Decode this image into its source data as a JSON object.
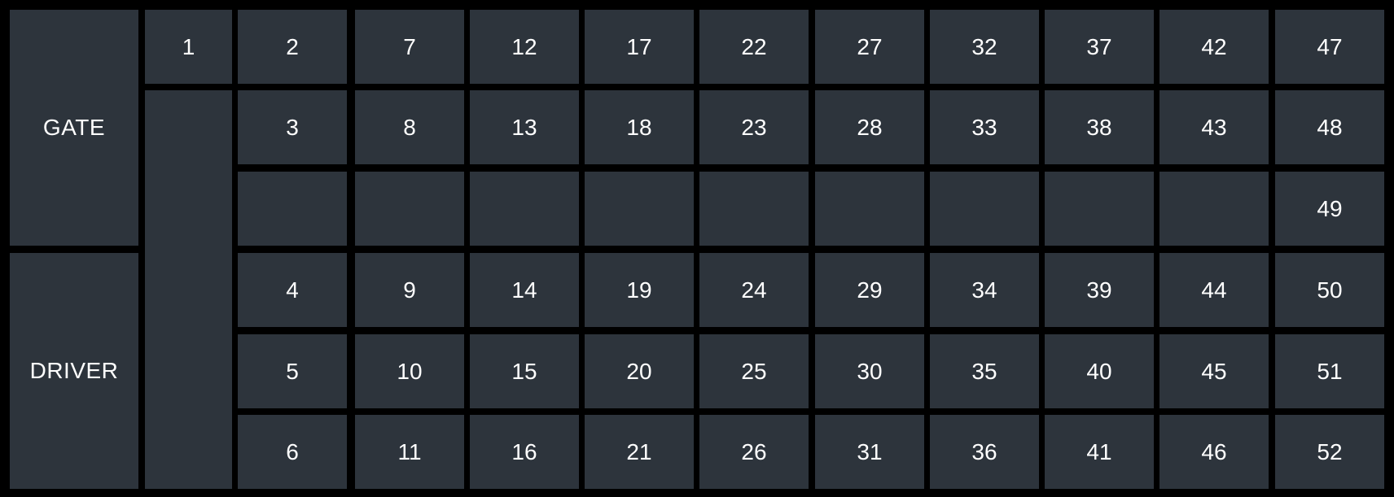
{
  "labels": {
    "gate": "GATE",
    "driver": "DRIVER"
  },
  "seat_first": "1",
  "columns": [
    [
      "2",
      "3",
      "",
      "4",
      "5",
      "6"
    ],
    [
      "7",
      "8",
      "",
      "9",
      "10",
      "11"
    ],
    [
      "12",
      "13",
      "",
      "14",
      "15",
      "16"
    ],
    [
      "17",
      "18",
      "",
      "19",
      "20",
      "21"
    ],
    [
      "22",
      "23",
      "",
      "24",
      "25",
      "26"
    ],
    [
      "27",
      "28",
      "",
      "29",
      "30",
      "31"
    ],
    [
      "32",
      "33",
      "",
      "34",
      "35",
      "36"
    ],
    [
      "37",
      "38",
      "",
      "39",
      "40",
      "41"
    ],
    [
      "42",
      "43",
      "",
      "44",
      "45",
      "46"
    ],
    [
      "47",
      "48",
      "49",
      "50",
      "51",
      "52"
    ]
  ],
  "colors": {
    "background": "#000000",
    "cell": "#2d343c",
    "text": "#ffffff"
  }
}
